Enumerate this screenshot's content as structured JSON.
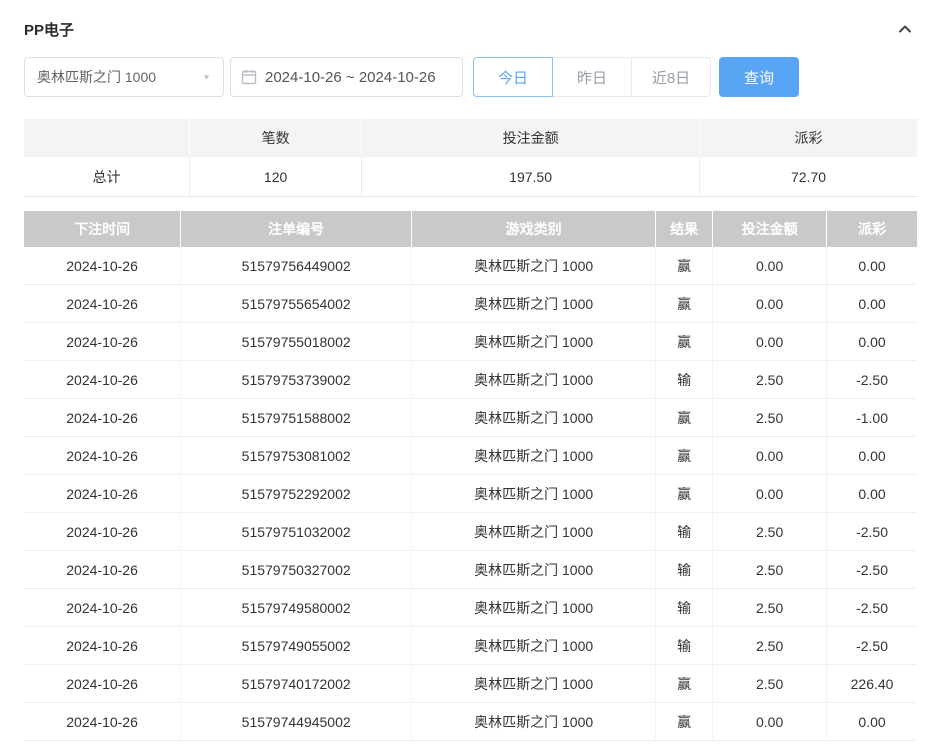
{
  "header": {
    "title": "PP电子"
  },
  "controls": {
    "game_select_value": "奥林匹斯之门 1000",
    "date_range_value": "2024-10-26 ~ 2024-10-26",
    "quick_buttons": [
      {
        "label": "今日",
        "active": true
      },
      {
        "label": "昨日",
        "active": false
      },
      {
        "label": "近8日",
        "active": false
      }
    ],
    "query_button_label": "查询"
  },
  "summary": {
    "headers": [
      "",
      "笔数",
      "投注金额",
      "派彩"
    ],
    "row": {
      "label": "总计",
      "count": "120",
      "bet_amount": "197.50",
      "payout": "72.70"
    }
  },
  "table": {
    "headers": [
      "下注时间",
      "注单编号",
      "游戏类别",
      "结果",
      "投注金额",
      "派彩"
    ],
    "rows": [
      [
        "2024-10-26",
        "51579756449002",
        "奥林匹斯之门 1000",
        "赢",
        "0.00",
        "0.00"
      ],
      [
        "2024-10-26",
        "51579755654002",
        "奥林匹斯之门 1000",
        "赢",
        "0.00",
        "0.00"
      ],
      [
        "2024-10-26",
        "51579755018002",
        "奥林匹斯之门 1000",
        "赢",
        "0.00",
        "0.00"
      ],
      [
        "2024-10-26",
        "51579753739002",
        "奥林匹斯之门 1000",
        "输",
        "2.50",
        "-2.50"
      ],
      [
        "2024-10-26",
        "51579751588002",
        "奥林匹斯之门 1000",
        "赢",
        "2.50",
        "-1.00"
      ],
      [
        "2024-10-26",
        "51579753081002",
        "奥林匹斯之门 1000",
        "赢",
        "0.00",
        "0.00"
      ],
      [
        "2024-10-26",
        "51579752292002",
        "奥林匹斯之门 1000",
        "赢",
        "0.00",
        "0.00"
      ],
      [
        "2024-10-26",
        "51579751032002",
        "奥林匹斯之门 1000",
        "输",
        "2.50",
        "-2.50"
      ],
      [
        "2024-10-26",
        "51579750327002",
        "奥林匹斯之门 1000",
        "输",
        "2.50",
        "-2.50"
      ],
      [
        "2024-10-26",
        "51579749580002",
        "奥林匹斯之门 1000",
        "输",
        "2.50",
        "-2.50"
      ],
      [
        "2024-10-26",
        "51579749055002",
        "奥林匹斯之门 1000",
        "输",
        "2.50",
        "-2.50"
      ],
      [
        "2024-10-26",
        "51579740172002",
        "奥林匹斯之门 1000",
        "赢",
        "2.50",
        "226.40"
      ],
      [
        "2024-10-26",
        "51579744945002",
        "奥林匹斯之门 1000",
        "赢",
        "0.00",
        "0.00"
      ]
    ]
  },
  "colors": {
    "accent_blue": "#58a5f5",
    "accent_border": "#8cc0f7",
    "negative_red": "#f04f4f",
    "table_header_gray": "#c9c9c9"
  }
}
